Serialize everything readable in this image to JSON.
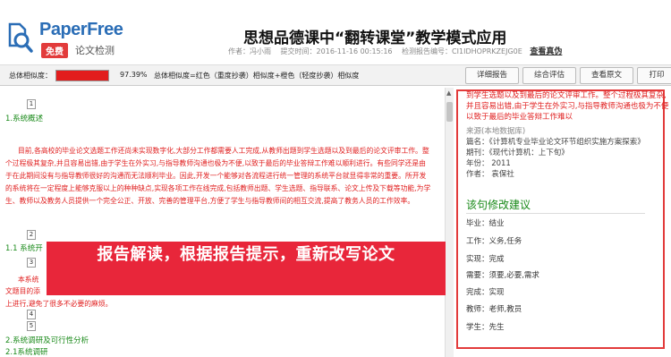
{
  "header": {
    "brand": "PaperFree",
    "badge": "免费",
    "subtitle": "论文检测",
    "title": "思想品德课中“翻转课堂”教学模式应用",
    "meta_author": "作者：冯小雨",
    "meta_time": "提交时间：2016-11-16 00:15:16",
    "meta_id": "检测报告编号：CI1IDHOPRKZEJG0E",
    "verify": "查看真伪"
  },
  "toolbar": {
    "similarity_label": "总体相似度：",
    "similarity_percent": "97.39%",
    "similarity_value": 0.9739,
    "legend": "总体相似度=红色（重度抄袭）相似度+橙色（轻度抄袭）相似度",
    "buttons": [
      "详细报告",
      "综合评估",
      "查看原文",
      "打印"
    ]
  },
  "content": {
    "page1": "1",
    "heading1": "1.系统概述",
    "para1": "目前,各高校的毕业论文选题工作还尚未实现数字化,大部分工作都需要人工完成,从教师出题到学生选题以及到最后的论文评审工作。整个过程极其复杂,并且容易出错,由于学生在外实习,与指导教师沟通也极为不便,以致于最后的毕业答辩工作难以顺利进行。有些同学还是由于在此期间没有与指导教师很好的沟通而无法顺利毕业。因此,开发一个能够对各流程进行统一管理的系统平台就显得非常的重要。所开发的系统将在一定程度上能够克服以上的种种缺点,实现各项工作在线完成,包括教师出题、学生选题、指导联系、论文上传及下载等功能,为学生、教师以及教务人员提供一个完全公正、开放、完善的管理平台,方便了学生与指导教师间的相互交流,提高了教务人员的工作效率。",
    "page2": "2",
    "heading2": "1.1 系统开",
    "page3": "3",
    "frag_a": "本系统",
    "frag_b": "文题目的添",
    "frag_c": "上进行,避免了很多不必要的麻烦。",
    "page4": "4",
    "page5": "5",
    "heading3": "2.系统调研及可行性分析",
    "heading4": "2.1系统调研"
  },
  "banner": {
    "text": "报告解读，根据报告提示，重新改写论文"
  },
  "right": {
    "match_red": "到学生选题以及到最后的论文评审工作。整个过程极其复杂,并且容易出错,由于学生在外实习,与指导教师沟通也极为不便以致于最后的毕业答辩工作难以",
    "source_db": "来源(本地数据库)",
    "source_title": "篇名：《计算机专业毕业论文环节组织实施方案探索》",
    "source_journal": "期刊：《现代计算机：上下旬》",
    "source_year": "年份： 2011",
    "source_author": "作者： 袁保社",
    "suggest_title": "该句修改建议",
    "suggestions": [
      "毕业：结业",
      "工作：义务,任务",
      "实现：完成",
      "需要：须要,必要,需求",
      "完成：实现",
      "教师：老师,教员",
      "学生：先生"
    ]
  }
}
